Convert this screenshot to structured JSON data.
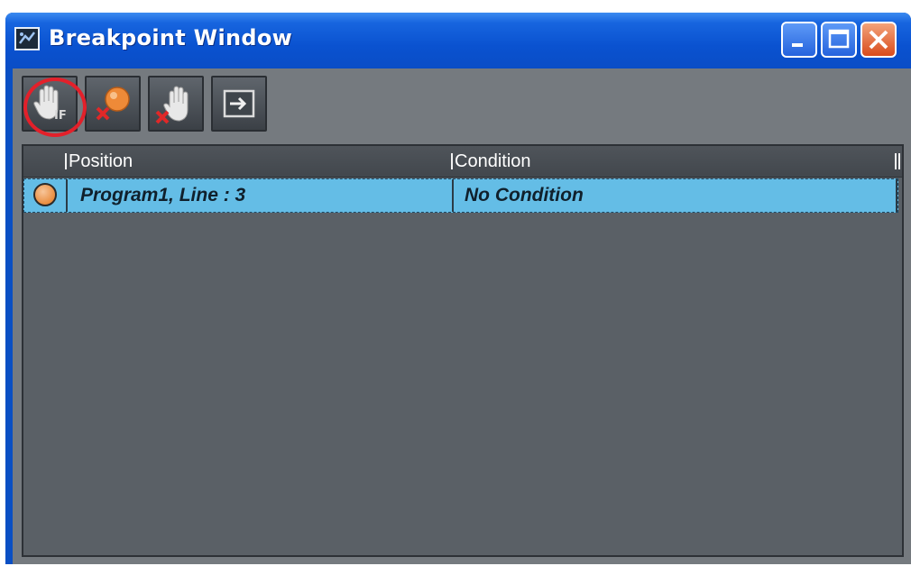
{
  "window": {
    "title": "Breakpoint Window"
  },
  "toolbar": {
    "buttons": [
      {
        "icon": "hand-if-icon"
      },
      {
        "icon": "remove-breakpoint-icon"
      },
      {
        "icon": "remove-all-breakpoints-icon"
      },
      {
        "icon": "go-to-icon"
      }
    ]
  },
  "table": {
    "columns": [
      "Position",
      "Condition"
    ],
    "rows": [
      {
        "icon": "breakpoint-dot-icon",
        "position": "Program1, Line : 3",
        "condition": "No Condition"
      }
    ]
  },
  "colors": {
    "titlebar": "#0a52d0",
    "selected_row": "#64bde6",
    "highlight_ring": "#e3202a",
    "breakpoint": "#e98d3f"
  }
}
